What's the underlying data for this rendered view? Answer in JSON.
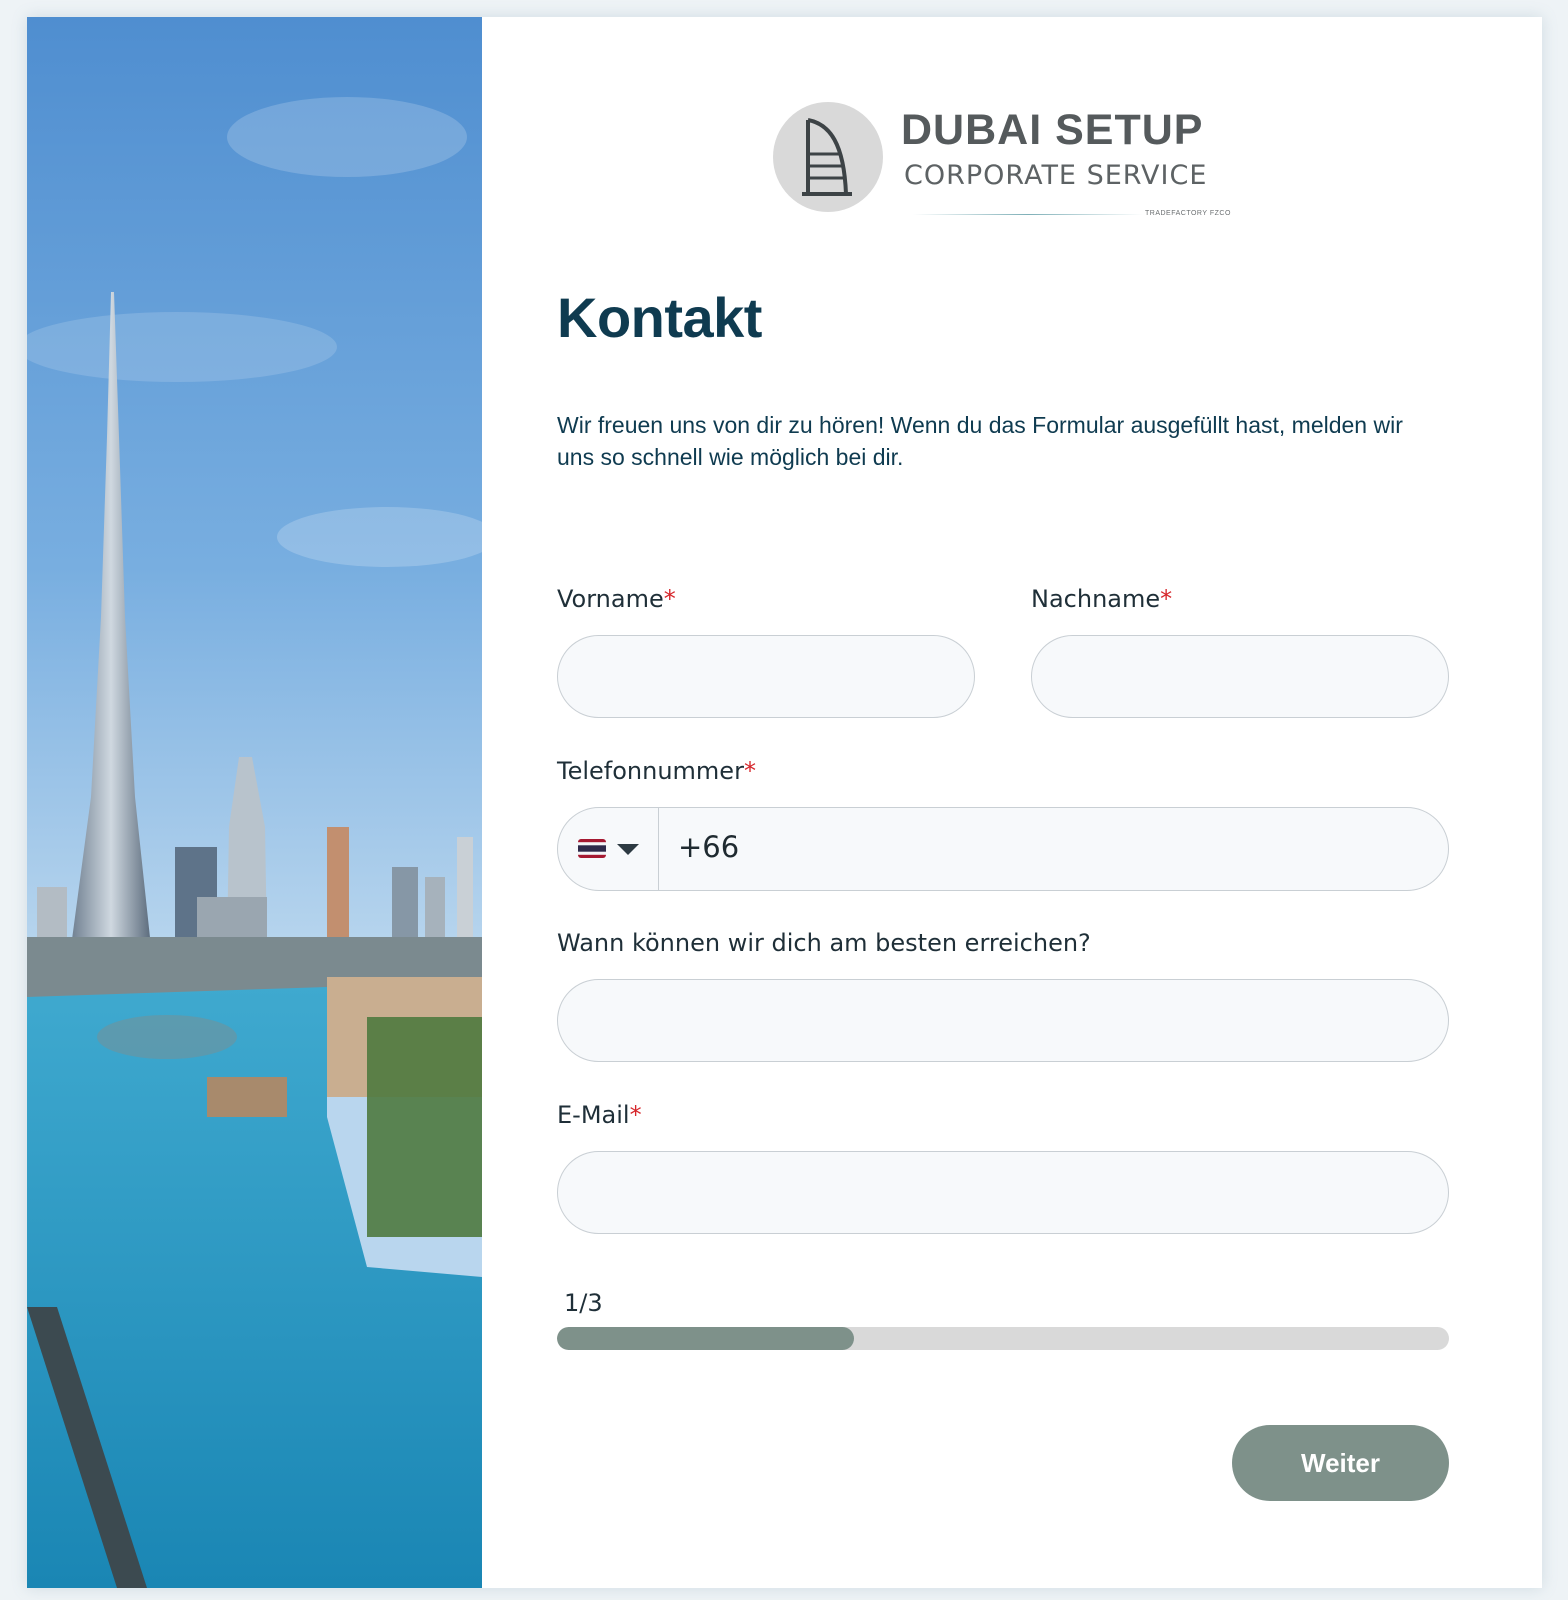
{
  "logo": {
    "title": "DUBAI SETUP",
    "subtitle": "CORPORATE SERVICE",
    "company": "TRADEFACTORY FZCO"
  },
  "page": {
    "title": "Kontakt",
    "intro": "Wir freuen uns von dir zu hören! Wenn du das Formular ausgefüllt hast, melden wir uns so schnell wie möglich bei dir."
  },
  "form": {
    "first_name": {
      "label": "Vorname",
      "required_mark": "*",
      "value": ""
    },
    "last_name": {
      "label": "Nachname",
      "required_mark": "*",
      "value": ""
    },
    "phone": {
      "label": "Telefonnummer",
      "required_mark": "*",
      "country_flag": "thailand-flag-icon",
      "value": "+66"
    },
    "best_time": {
      "label": "Wann können wir dich am besten erreichen?",
      "value": ""
    },
    "email": {
      "label": "E-Mail",
      "required_mark": "*",
      "value": ""
    }
  },
  "progress": {
    "step_text": "1/3",
    "fraction": 0.3333
  },
  "buttons": {
    "next": "Weiter"
  },
  "colors": {
    "heading": "#0f3b50",
    "required": "#d6262b",
    "accent": "#7e918a",
    "track": "#d9d9d9"
  }
}
